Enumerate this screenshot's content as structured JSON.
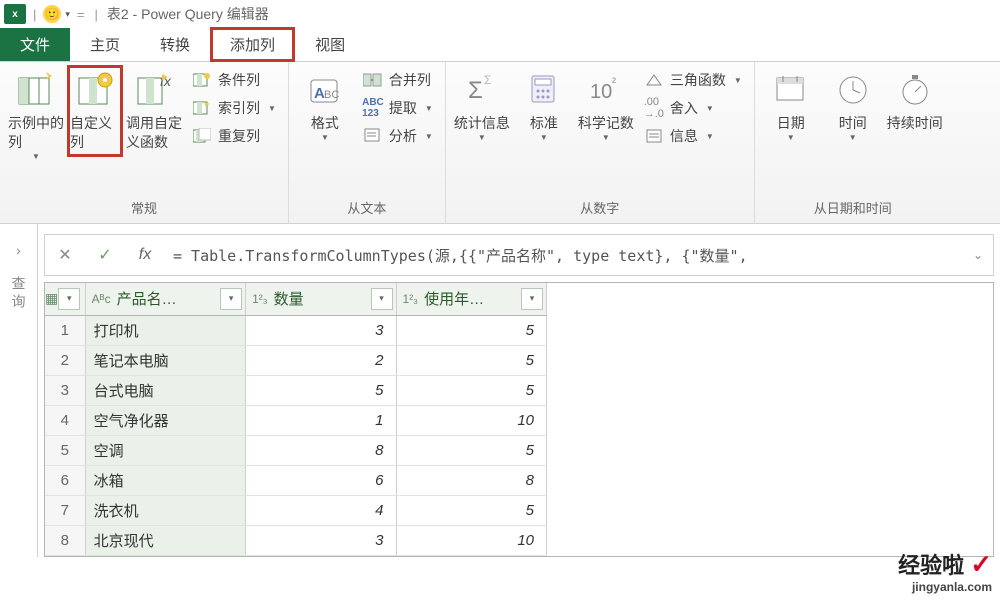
{
  "titlebar": {
    "app_icon_text": "x",
    "qat_face": "🙂",
    "qat_caret": "▾",
    "sep": "|",
    "title": "表2 - Power Query 编辑器"
  },
  "tabs": {
    "file": "文件",
    "home": "主页",
    "transform": "转换",
    "add_column": "添加列",
    "view": "视图"
  },
  "ribbon": {
    "general": {
      "label": "常规",
      "from_examples": "示例中的列",
      "custom_column": "自定义列",
      "invoke_fn": "调用自定义函数",
      "conditional": "条件列",
      "index": "索引列",
      "duplicate": "重复列"
    },
    "text": {
      "label": "从文本",
      "format": "格式",
      "merge": "合并列",
      "extract": "提取",
      "parse": "分析"
    },
    "number": {
      "label": "从数字",
      "stats": "统计信息",
      "standard": "标准",
      "scientific": "科学记数",
      "trig": "三角函数",
      "rounding": "舍入",
      "info": "信息"
    },
    "datetime": {
      "label": "从日期和时间",
      "date": "日期",
      "time": "时间",
      "duration": "持续时间"
    }
  },
  "sidebar": {
    "label": "查询"
  },
  "formula": {
    "cancel_glyph": "✕",
    "commit_glyph": "✓",
    "fx": "fx",
    "text": "= Table.TransformColumnTypes(源,{{\"产品名称\", type text}, {\"数量\","
  },
  "columns": {
    "product": "产品名…",
    "qty": "数量",
    "years": "使用年…"
  },
  "type_icons": {
    "text": "Aᴮc",
    "int": "1²₃"
  },
  "rows": [
    {
      "n": "1",
      "p": "打印机",
      "q": "3",
      "y": "5"
    },
    {
      "n": "2",
      "p": "笔记本电脑",
      "q": "2",
      "y": "5"
    },
    {
      "n": "3",
      "p": "台式电脑",
      "q": "5",
      "y": "5"
    },
    {
      "n": "4",
      "p": "空气净化器",
      "q": "1",
      "y": "10"
    },
    {
      "n": "5",
      "p": "空调",
      "q": "8",
      "y": "5"
    },
    {
      "n": "6",
      "p": "冰箱",
      "q": "6",
      "y": "8"
    },
    {
      "n": "7",
      "p": "洗衣机",
      "q": "4",
      "y": "5"
    },
    {
      "n": "8",
      "p": "北京现代",
      "q": "3",
      "y": "10"
    }
  ],
  "watermark": {
    "line1": "经验啦",
    "check": "✓",
    "line2": "jingyanla.com"
  }
}
